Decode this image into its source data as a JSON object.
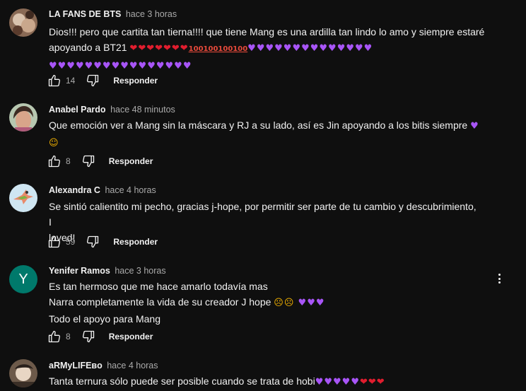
{
  "comments": [
    {
      "author": "LA FANS DE BTS",
      "time": "hace 3 horas",
      "lines": [
        "Dios!!! pero que cartita tan tierna!!!! que tiene Mang es una ardilla tan lindo lo amo y siempre estaré",
        "apoyando a BT21"
      ],
      "likes": "14",
      "reply": "Responder"
    },
    {
      "author": "Anabel Pardo",
      "time": "hace 48 minutos",
      "lines": [
        "Que emoción ver a Mang sin la máscara  y RJ a su lado, así es Jin apoyando a los bitis siempre"
      ],
      "likes": "8",
      "reply": "Responder"
    },
    {
      "author": "Alexandra C",
      "time": "hace 4 horas",
      "lines": [
        "Se sintió calientito mi pecho, gracias j-hope, por permitir ser parte de tu cambio y descubrimiento, I",
        "loved!"
      ],
      "likes": "59",
      "reply": "Responder"
    },
    {
      "author": "Yenifer Ramos",
      "time": "hace 3 horas",
      "avatar_letter": "Y",
      "lines": [
        "Es tan hermoso que me hace amarlo todavía mas",
        "Narra completamente la vida de su creador J hope",
        "Todo el apoyo para Mang"
      ],
      "likes": "8",
      "reply": "Responder"
    },
    {
      "author": "aRMyLIFEʙᴏ",
      "time": "hace 4 horas",
      "lines": [
        "Tanta ternura sólo puede ser posible cuando se trata de hobi"
      ]
    }
  ],
  "icons": {
    "like": "thumb-up-icon",
    "dislike": "thumb-down-icon",
    "menu": "more-vert-icon"
  },
  "colors": {
    "background": "#0f0f0f",
    "text": "#f1f1f1",
    "secondary": "#aaaaaa",
    "avatar_y": "#00796b"
  }
}
